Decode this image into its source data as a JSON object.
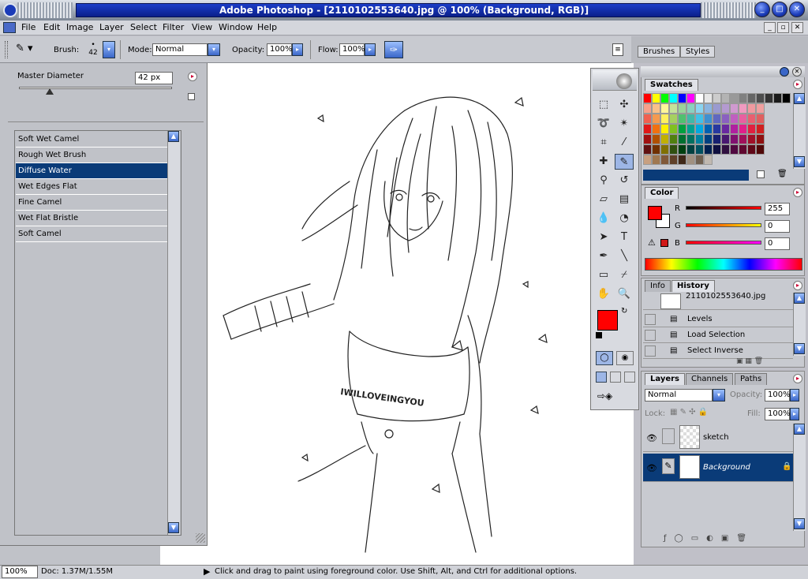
{
  "app": {
    "title": "Adobe Photoshop - [2110102553640.jpg @ 100% (Background, RGB)]"
  },
  "menu": [
    "File",
    "Edit",
    "Image",
    "Layer",
    "Select",
    "Filter",
    "View",
    "Window",
    "Help"
  ],
  "options": {
    "brush_label": "Brush:",
    "brush_size": "42",
    "mode_label": "Mode:",
    "mode_value": "Normal",
    "opacity_label": "Opacity:",
    "opacity_value": "100%",
    "flow_label": "Flow:",
    "flow_value": "100%"
  },
  "well_tabs": [
    "Brushes",
    "Styles"
  ],
  "brush_panel": {
    "master_label": "Master Diameter",
    "master_value": "42 px",
    "master_level": 0.2,
    "items": [
      "Soft Wet Camel",
      "Rough Wet Brush",
      "Diffuse Water",
      "Wet Edges Flat",
      "Fine Camel",
      "Wet Flat Bristle",
      "Soft Camel"
    ],
    "selected": "Diffuse Water"
  },
  "swatches": {
    "tab": "Swatches",
    "rows": [
      [
        "#ff0000",
        "#ffff00",
        "#00ff00",
        "#00ffff",
        "#0000ff",
        "#ff00ff",
        "#ffffff",
        "#e6e6e6",
        "#cccccc",
        "#b3b3b3",
        "#999999",
        "#808080",
        "#666666",
        "#4d4d4d",
        "#333333",
        "#1a1a1a",
        "#000000"
      ],
      [
        "#f7a08a",
        "#f9c08a",
        "#fff59a",
        "#c5e29a",
        "#9ad49a",
        "#8ad0c0",
        "#8ad4f0",
        "#8ab4e0",
        "#9a9ad0",
        "#b49ad0",
        "#d09ad0",
        "#f09ac0",
        "#f09aa0",
        "#f0a0a0"
      ],
      [
        "#f06050",
        "#f59a50",
        "#fff060",
        "#a6d060",
        "#50c070",
        "#40b8a8",
        "#40c0e8",
        "#4090d0",
        "#6068c0",
        "#8a60c0",
        "#c060c0",
        "#e860a0",
        "#e86070",
        "#e06060"
      ],
      [
        "#e01818",
        "#f07010",
        "#fff000",
        "#80c020",
        "#00a040",
        "#00a090",
        "#00a8e0",
        "#0060b0",
        "#2838a0",
        "#6828a0",
        "#b020a0",
        "#e0208a",
        "#e02040",
        "#d02020"
      ],
      [
        "#a01010",
        "#b05000",
        "#c0b000",
        "#508010",
        "#007030",
        "#007060",
        "#0080a0",
        "#004080",
        "#182070",
        "#481870",
        "#801070",
        "#a0105a",
        "#a01028",
        "#901010"
      ],
      [
        "#601010",
        "#703000",
        "#807000",
        "#305010",
        "#004010",
        "#004040",
        "#005060",
        "#002050",
        "#101040",
        "#301040",
        "#500840",
        "#600830",
        "#600818",
        "#500808"
      ],
      [
        "#c8a080",
        "#a07850",
        "#805838",
        "#604028",
        "#402818",
        "#a09080",
        "#706050",
        "#c0b8b0"
      ]
    ]
  },
  "color": {
    "tab": "Color",
    "r_label": "R",
    "g_label": "G",
    "b_label": "B",
    "r_value": "255",
    "g_value": "0",
    "b_value": "0",
    "fg": "#ff0000",
    "bg": "#ffffff"
  },
  "history": {
    "tabs": [
      "Info",
      "History"
    ],
    "snapshot": "2110102553640.jpg",
    "items": [
      "Levels",
      "Load Selection",
      "Select Inverse"
    ]
  },
  "layers": {
    "tabs": [
      "Layers",
      "Channels",
      "Paths"
    ],
    "mode": "Normal",
    "opacity_label": "Opacity:",
    "opacity_value": "100%",
    "lock_label": "Lock:",
    "fill_label": "Fill:",
    "fill_value": "100%",
    "items": [
      "sketch",
      "Background"
    ]
  },
  "status": {
    "zoom": "100%",
    "doc": "Doc: 1.37M/1.55M",
    "hint": "Click and drag to paint using foreground color.  Use Shift, Alt, and Ctrl for additional options."
  },
  "artwork": {
    "shirt_text": "IWILLOVEINGYOU"
  }
}
